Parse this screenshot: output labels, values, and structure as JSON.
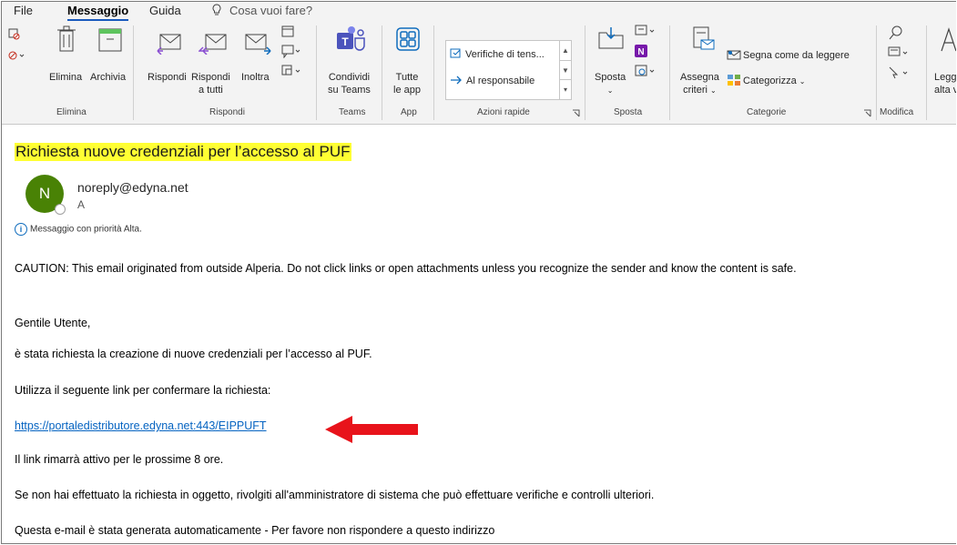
{
  "menu": {
    "tabs": [
      "File",
      "Messaggio",
      "Guida"
    ],
    "active": "Messaggio",
    "tell_me": "Cosa vuoi fare?"
  },
  "ribbon": {
    "elimina": {
      "group": "Elimina",
      "delete": "Elimina",
      "archive": "Archivia"
    },
    "rispondi": {
      "group": "Rispondi",
      "reply": "Rispondi",
      "reply_all_1": "Rispondi",
      "reply_all_2": "a tutti",
      "forward": "Inoltra"
    },
    "teams": {
      "group": "Teams",
      "share_1": "Condividi",
      "share_2": "su Teams"
    },
    "app": {
      "group": "App",
      "all_1": "Tutte",
      "all_2": "le app"
    },
    "azioni_rapide": {
      "group": "Azioni rapide",
      "item1": "Verifiche di tens...",
      "item2": "Al responsabile"
    },
    "sposta": {
      "group": "Sposta",
      "move": "Sposta"
    },
    "categorie": {
      "group": "Categorie",
      "assign_1": "Assegna",
      "assign_2": "criteri",
      "mark_unread": "Segna come da leggere",
      "categorize": "Categorizza"
    },
    "modifica": {
      "group": "Modifica"
    },
    "read_aloud_1": "Legg",
    "read_aloud_2": "alta v"
  },
  "email": {
    "subject": "Richiesta nuove credenziali per l’accesso al PUF",
    "avatar_initial": "N",
    "sender": "noreply@edyna.net",
    "to": "A",
    "priority": "Messaggio con priorità Alta.",
    "caution": "CAUTION: This email originated from outside Alperia. Do not click links or open attachments unless you recognize the sender and know the content is safe.",
    "greeting": "Gentile Utente,",
    "line1": "è stata richiesta la creazione di nuove credenziali per l’accesso al PUF.",
    "line2": "Utilizza il seguente link per confermare la richiesta:",
    "link": "https://portaledistributore.edyna.net:443/EIPPUFT",
    "line3": "Il link rimarrà attivo per le prossime 8 ore.",
    "line4": "Se non hai effettuato la richiesta in oggetto, rivolgiti all'amministratore di sistema che può effettuare verifiche e controlli ulteriori.",
    "line5": "Questa e-mail è stata generata automaticamente - Per favore non rispondere a questo indirizzo"
  },
  "colors": {
    "accent": "#185abd",
    "avatar": "#498205",
    "highlight": "#ffff33",
    "link": "#0563c1",
    "arrow": "#e8131b"
  }
}
